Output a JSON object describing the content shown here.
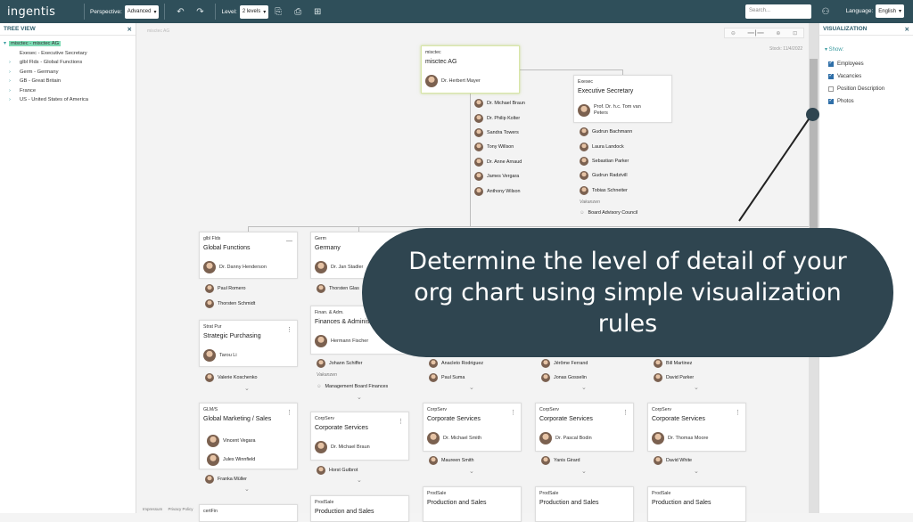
{
  "topbar": {
    "logo": "ingentis",
    "perspective_label": "Perspective:",
    "perspective_value": "Advanced",
    "level_label": "Level:",
    "level_value": "2 levels",
    "search_placeholder": "Search...",
    "language_label": "Language:",
    "language_value": "English"
  },
  "tree": {
    "title": "TREE VIEW",
    "items": [
      {
        "label": "misctec - misctec AG",
        "selected": true
      },
      {
        "label": "Exesec - Executive Secretary"
      },
      {
        "label": "glbl Flds - Global Functions"
      },
      {
        "label": "Germ - Germany"
      },
      {
        "label": "GB - Great Britain"
      },
      {
        "label": "France"
      },
      {
        "label": "US - United States of America"
      }
    ]
  },
  "footer": {
    "impressum": "Impressum",
    "privacy": "Privacy Policy"
  },
  "canvas": {
    "ghost_tag": "misctec AG",
    "stock_note": "Stock: 11/4/2022"
  },
  "visualization": {
    "title": "VISUALIZATION",
    "show_label": "▾ Show:",
    "options": [
      {
        "label": "Employees",
        "checked": true
      },
      {
        "label": "Vacancies",
        "checked": true
      },
      {
        "label": "Position Description",
        "checked": false
      },
      {
        "label": "Photos",
        "checked": true
      }
    ]
  },
  "cards": {
    "root": {
      "code": "misctec",
      "name": "misctec AG",
      "head": "Dr. Herbert Mayer"
    },
    "exesec": {
      "code": "Exesec",
      "name": "Executive Secretary",
      "head": "Prof. Dr. h.c. Tom van Peters"
    },
    "global": {
      "code": "glbl Flds",
      "name": "Global Functions",
      "head": "Dr. Danny Henderson"
    },
    "germany": {
      "code": "Germ",
      "name": "Germany",
      "head": "Dr. Jan Stadler"
    },
    "strat": {
      "code": "Strat Pur",
      "name": "Strategic Purchasing",
      "head": "Tarou Li"
    },
    "finance": {
      "code": "Finan. & Adm.",
      "name": "Finances & Administration",
      "head": "Hermann Fischer"
    },
    "glmk": {
      "code": "GLM/S",
      "name": "Global Marketing / Sales"
    },
    "corp1": {
      "code": "CorpServ",
      "name": "Corporate Services",
      "head": "Dr. Michael Braun"
    },
    "corp2": {
      "code": "CorpServ",
      "name": "Corporate Services",
      "head": "Dr. Michael Smith"
    },
    "corp3": {
      "code": "CorpServ",
      "name": "Corporate Services",
      "head": "Dr. Pascal Bodin"
    },
    "corp4": {
      "code": "CorpServ",
      "name": "Corporate Services",
      "head": "Dr. Thomas Moore"
    },
    "prod1": {
      "code": "ProdSale",
      "name": "Production and Sales"
    },
    "prod2": {
      "code": "ProdSale",
      "name": "Production and Sales"
    },
    "prod3": {
      "code": "ProdSale",
      "name": "Production and Sales"
    },
    "prod4": {
      "code": "ProdSale",
      "name": "Production and Sales"
    },
    "certfin": {
      "code": "certFin"
    }
  },
  "people": {
    "root_staff": [
      "Dr. Michael Braun",
      "Dr. Philip Kolter",
      "Sandra Towers",
      "Tony Willson",
      "Dr. Anne Arnaud",
      "James Vergara",
      "Anthony Wilson"
    ],
    "exesec_staff": [
      "Gudrun Bachmann",
      "Laura Landock",
      "Sebastian Parker",
      "Gudrun Radzivill",
      "Tobias Schneiter"
    ],
    "exesec_vacancy_label": "Vakanzen",
    "exesec_vacancy": "Board Advisory Council",
    "global_staff": [
      "Paul Romero",
      "Thorsten Schmidt"
    ],
    "germany_staff": [
      "Thorsten Glas"
    ],
    "strat_staff": [
      "Valerie Koschenko"
    ],
    "finance_staff": [
      "Johann Schiffer"
    ],
    "finance_vacancy_label": "Vakanzen",
    "finance_vacancy": "Management Board Finances",
    "glmk_staff": [
      "Vincent Vegara",
      "Jules Winnfield"
    ],
    "glmk_extra": "Franka Müller",
    "corp1_staff": [
      "Horst Gutbrot"
    ],
    "col3_staff": [
      "Anacleto Rodriguez",
      "Paul Suma"
    ],
    "col4_staff": [
      "Jérôme Ferrand",
      "Jonas Gosselin"
    ],
    "col5_staff": [
      "Bill Martinez",
      "David Parker"
    ],
    "corp2_staff": [
      "Maureen Smith"
    ],
    "corp3_staff": [
      "Yanis Girard"
    ],
    "corp4_staff": [
      "David White"
    ]
  },
  "callout": {
    "text": "Determine the level of detail of your org chart using simple visualization rules"
  }
}
